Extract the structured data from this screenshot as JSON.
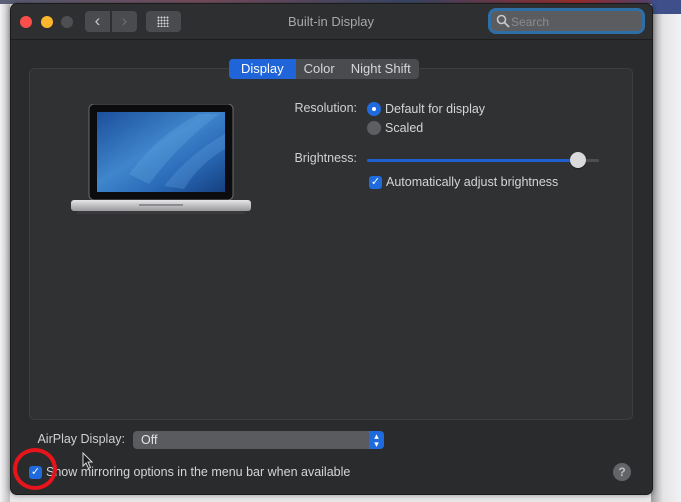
{
  "window": {
    "title": "Built-in Display",
    "search": {
      "placeholder": "Search",
      "value": ""
    }
  },
  "toolbar": {
    "back_glyph": "‹",
    "forward_glyph": "›",
    "show_all_icon": "grid-icon"
  },
  "tabs": [
    {
      "label": "Display",
      "active": true
    },
    {
      "label": "Color",
      "active": false
    },
    {
      "label": "Night Shift",
      "active": false
    }
  ],
  "display": {
    "preview_icon": "laptop-image",
    "resolution": {
      "label": "Resolution:",
      "options": [
        {
          "label": "Default for display",
          "selected": true
        },
        {
          "label": "Scaled",
          "selected": false
        }
      ]
    },
    "brightness": {
      "label": "Brightness:",
      "value_fraction": 0.91
    },
    "auto_brightness": {
      "label": "Automatically adjust brightness",
      "checked": true,
      "check_glyph": "✓"
    }
  },
  "airplay": {
    "label": "AirPlay Display:",
    "selected": "Off",
    "arrows_glyph": "⌃⌄"
  },
  "mirroring": {
    "label": "Show mirroring options in the menu bar when available",
    "checked": true,
    "check_glyph": "✓"
  },
  "help": {
    "glyph": "?"
  },
  "colors": {
    "accent": "#1f6bdd",
    "window_bg": "#2a2b2d",
    "annotation": "#e8141c"
  }
}
